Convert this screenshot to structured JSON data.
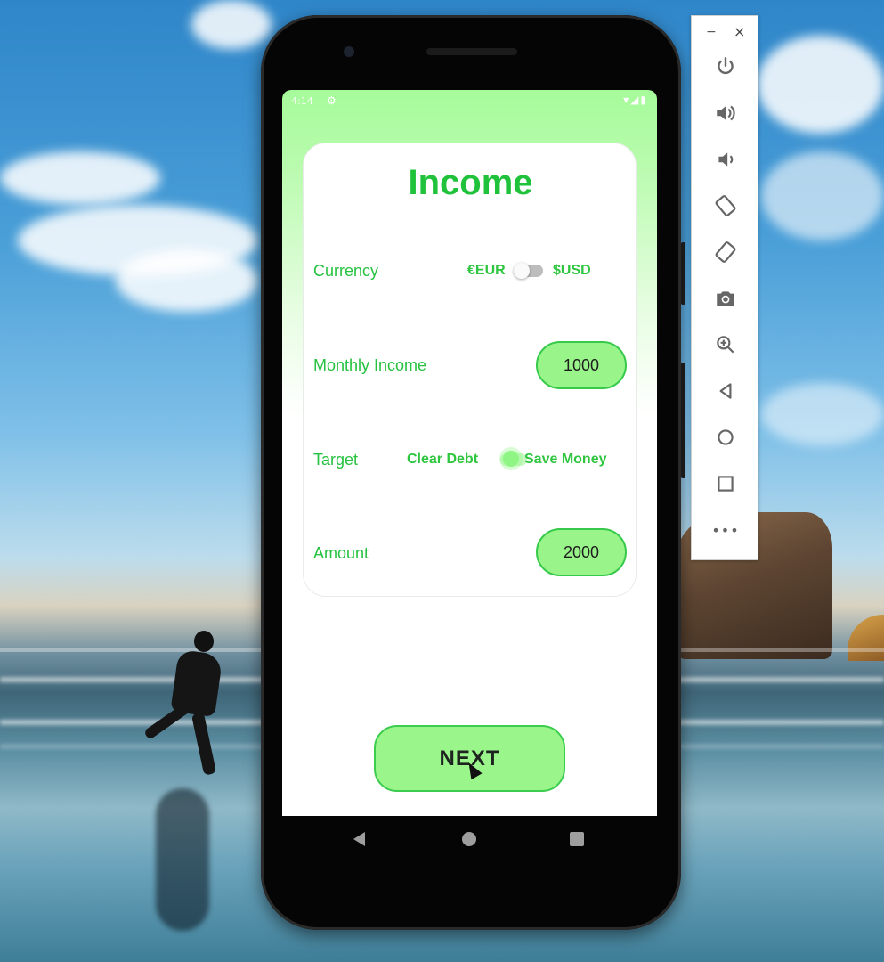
{
  "phone": {
    "status_bar": {
      "time": "4:14",
      "gear_icon": "settings-gear-icon",
      "right_icons": "▾◢▮"
    },
    "card": {
      "title": "Income",
      "currency": {
        "label": "Currency",
        "left_option": "€EUR",
        "right_option": "$USD",
        "selected": "EUR"
      },
      "monthly_income": {
        "label": "Monthly Income",
        "value": "1000"
      },
      "target": {
        "label": "Target",
        "left_option": "Clear Debt",
        "right_option": "Save Money",
        "selected": "Save Money"
      },
      "amount": {
        "label": "Amount",
        "value": "2000"
      }
    },
    "next_button": {
      "label": "NEXT"
    },
    "nav": {
      "back_icon": "back-triangle-icon",
      "home_icon": "home-circle-icon",
      "recents_icon": "recents-square-icon"
    }
  },
  "emulator_toolbar": {
    "minimize": "−",
    "close": "×",
    "buttons": [
      "power",
      "volume-up",
      "volume-down",
      "rotate-left",
      "rotate-right",
      "screenshot",
      "zoom",
      "back",
      "home",
      "overview",
      "more"
    ],
    "more_label": "•••"
  },
  "colors": {
    "accent_green": "#1fc23a",
    "pill_fill": "#99f58a",
    "pill_border": "#36c94a"
  }
}
